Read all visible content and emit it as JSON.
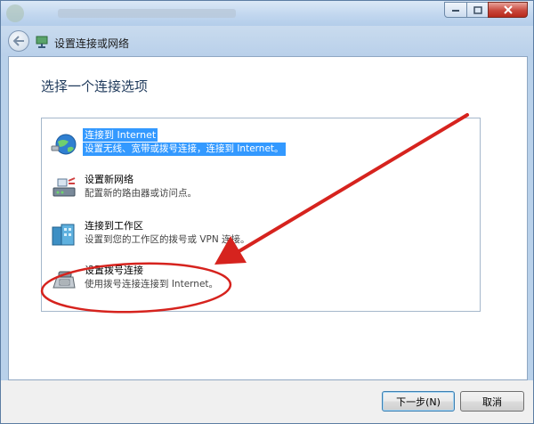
{
  "window": {
    "nav_title": "设置连接或网络"
  },
  "main": {
    "heading": "选择一个连接选项"
  },
  "options": [
    {
      "title": "连接到 Internet",
      "desc": "设置无线、宽带或拨号连接，连接到 Internet。",
      "selected": true,
      "icon": "globe-network-icon"
    },
    {
      "title": "设置新网络",
      "desc": "配置新的路由器或访问点。",
      "selected": false,
      "icon": "router-icon"
    },
    {
      "title": "连接到工作区",
      "desc": "设置到您的工作区的拨号或 VPN 连接。",
      "selected": false,
      "icon": "workplace-building-icon"
    },
    {
      "title": "设置拨号连接",
      "desc": "使用拨号连接连接到 Internet。",
      "selected": false,
      "icon": "dialup-modem-icon"
    }
  ],
  "footer": {
    "next_label": "下一步(N)",
    "cancel_label": "取消"
  },
  "colors": {
    "selection": "#3399ff",
    "heading": "#1e395b",
    "annotation": "#d6231e"
  }
}
